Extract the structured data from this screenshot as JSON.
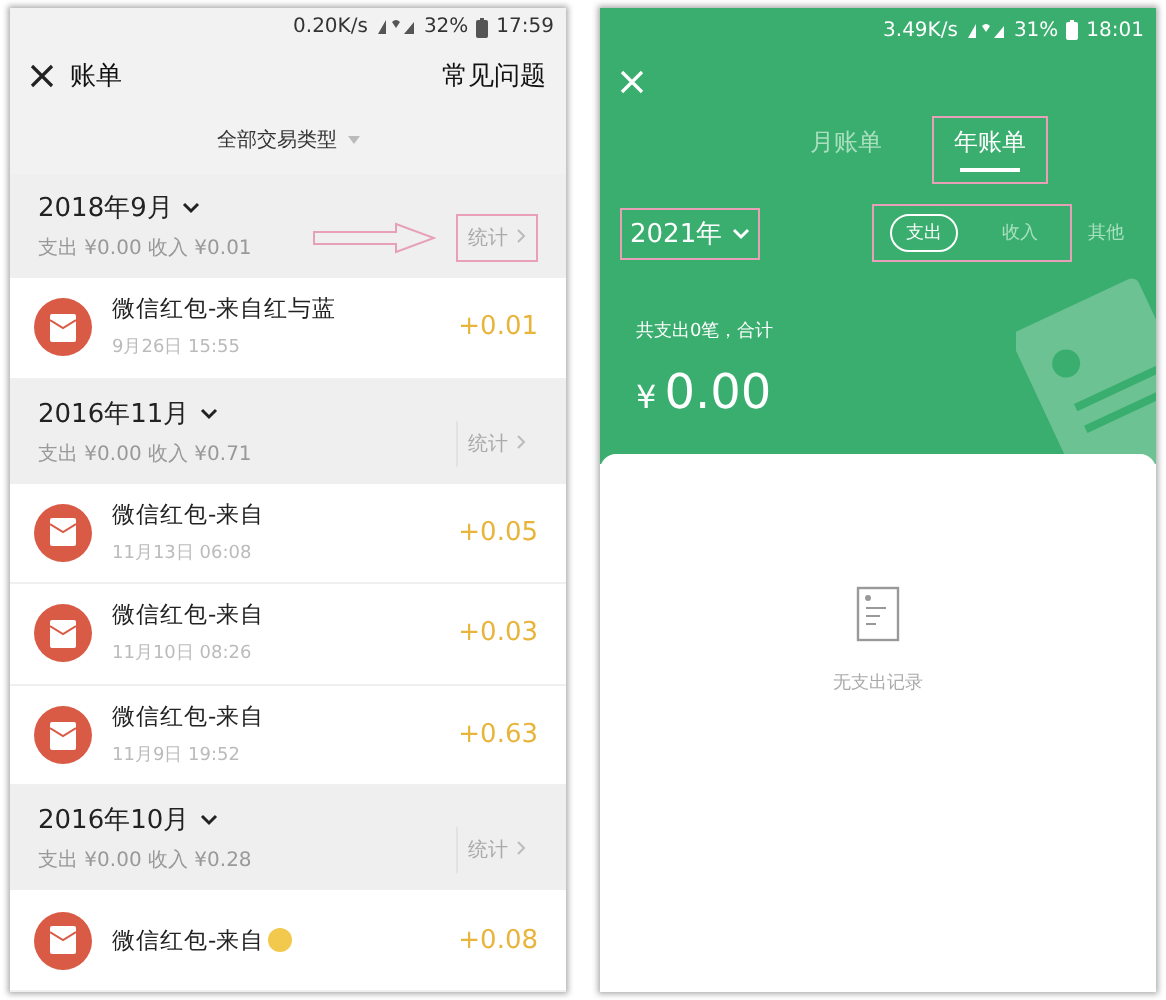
{
  "left": {
    "status_bar": {
      "speed": "0.20K/s",
      "battery": "32%",
      "time": "17:59"
    },
    "header": {
      "title": "账单",
      "action": "常见问题"
    },
    "filter": "全部交易类型",
    "months": [
      {
        "title": "2018年9月",
        "summary": "支出 ¥0.00 收入 ¥0.01",
        "stats": "统计",
        "highlighted": true,
        "arrow": true,
        "rows": [
          {
            "title": "微信红包-来自红与蓝",
            "date": "9月26日 15:55",
            "amount": "+0.01"
          }
        ]
      },
      {
        "title": "2016年11月",
        "summary": "支出 ¥0.00 收入 ¥0.71",
        "stats": "统计",
        "highlighted": false,
        "arrow": false,
        "rows": [
          {
            "title": "微信红包-来自",
            "date": "11月13日 06:08",
            "amount": "+0.05"
          },
          {
            "title": "微信红包-来自",
            "date": "11月10日 08:26",
            "amount": "+0.03"
          },
          {
            "title": "微信红包-来自",
            "date": "11月9日 19:52",
            "amount": "+0.63"
          }
        ]
      },
      {
        "title": "2016年10月",
        "summary": "支出 ¥0.00 收入 ¥0.28",
        "stats": "统计",
        "highlighted": false,
        "arrow": false,
        "rows": [
          {
            "title": "微信红包-来自",
            "emoji": true,
            "amount": "+0.08"
          }
        ]
      }
    ]
  },
  "right": {
    "status_bar": {
      "speed": "3.49K/s",
      "battery": "31%",
      "time": "18:01"
    },
    "tabs": [
      {
        "label": "月账单",
        "selected": false,
        "highlighted": false
      },
      {
        "label": "年账单",
        "selected": true,
        "highlighted": true
      }
    ],
    "year": {
      "label": "2021年",
      "highlighted": true
    },
    "types": {
      "highlighted": true,
      "items": [
        {
          "label": "支出",
          "selected": true
        },
        {
          "label": "收入",
          "selected": false
        }
      ]
    },
    "other": "其他",
    "summary": "共支出0笔，合计",
    "currency": "¥",
    "total": "0.00",
    "empty_text": "无支出记录"
  }
}
